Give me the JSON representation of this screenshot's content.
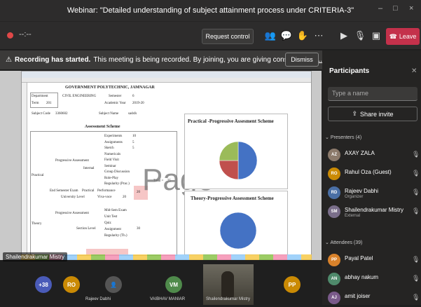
{
  "window": {
    "title": "Webinar: \"Detailed understanding of subject attainment process under CRITERIA-3\"",
    "controls": [
      "–",
      "□",
      "×"
    ]
  },
  "toolbar": {
    "elapsed": "--:--",
    "request_control": "Request control",
    "icons": [
      "people-icon",
      "chat-icon",
      "hand-icon",
      "more-icon",
      "camera-off-icon",
      "mic-off-icon",
      "share-icon"
    ],
    "glyphs": {
      "people": "👥",
      "chat": "💬",
      "hand": "✋",
      "more": "⋯",
      "camera": "▶",
      "mic": "🎙",
      "share": "▣"
    },
    "leave_label": "Leave",
    "leave_color": "#c4314b"
  },
  "banner": {
    "bold": "Recording has started.",
    "message": "This meeting is being recorded. By joining, you are giving consent for this meeting to be recorded.",
    "more": "Priv...",
    "dismiss": "Dismiss"
  },
  "shared_screen": {
    "sheet_title": "GOVERNMENT POLYTECHNIC, JAMNAGAR",
    "department_label": "Department",
    "department_value": "CIVIL ENGINEERING",
    "semester_label": "Semester",
    "semester_value": "6",
    "term_label": "Term",
    "term_value": "201",
    "academic_year_label": "Academic Year",
    "academic_year_value": "2019-20",
    "subject_code_label": "Subject Code",
    "subject_code_value": "3360602",
    "subject_name_label": "Subject Name",
    "subject_name_value": "sadsfs",
    "assessment_scheme": "Assessment Scheme",
    "practical_label": "Practical",
    "progressive_assessment": "Progressive Assessment",
    "internal": "Internal",
    "theory_label": "Theory",
    "end_sem_exam": "End Semester Exam",
    "practical_col": "Practical",
    "performance": "Performance",
    "viva": "Viva-voce",
    "university_level": "University Level",
    "section_level": "Section Level",
    "total_label": "Total =",
    "total_value": "75",
    "end_value": "20",
    "end_value_label": "20",
    "row_items": [
      "Experiments",
      "Assignments",
      "Sketch",
      "Numericals",
      "Field Visit",
      "Seminar",
      "Group Discussion",
      "Role-Play",
      "Regularity (Prac.)"
    ],
    "row_values": [
      "10",
      "5",
      "5"
    ],
    "theory_items": [
      "Mid-Sem Exam",
      "Unit Test",
      "Quiz",
      "Assignment",
      "Regularity (Th.)"
    ],
    "theory_values": [
      "30"
    ],
    "watermark": "Page",
    "chart1_title": "Practical -Progressive Assesment Scheme",
    "chart2_title": "Theory-Progressive Assessment Scheme",
    "presenter_tag": "Shailendrakumar Mistry"
  },
  "chart_data": [
    {
      "type": "pie",
      "title": "Practical -Progressive Assesment Scheme",
      "labels": [
        "Experiments",
        "Assignments",
        "Sketch"
      ],
      "values": [
        50,
        25,
        25
      ],
      "colors": [
        "#4472c4",
        "#c0504d",
        "#9bbb59"
      ]
    },
    {
      "type": "pie",
      "title": "Theory-Progressive Assessment Scheme",
      "labels": [
        "Mid-Sem Exam"
      ],
      "values": [
        100
      ],
      "colors": [
        "#4472c4"
      ]
    }
  ],
  "participants": {
    "title": "Participants",
    "search_placeholder": "Type a name",
    "share_invite": "Share invite",
    "presenters_header": "Presenters (4)",
    "attendees_header": "Attendees (39)",
    "presenters": [
      {
        "initials": "AZ",
        "name": "AXAY ZALA",
        "role": "",
        "color": "#8c7a6b"
      },
      {
        "initials": "RO",
        "name": "Rahul Oza (Guest)",
        "role": "",
        "color": "#ca8a04"
      },
      {
        "initials": "RD",
        "name": "Rajeev Dabhi",
        "role": "Organizer",
        "color": "#4a6fa5"
      },
      {
        "initials": "SM",
        "name": "Shailendrakumar Mistry",
        "role": "External",
        "color": "#7a6e8a"
      }
    ],
    "attendees": [
      {
        "initials": "PP",
        "name": "Payal Patel",
        "role": "",
        "color": "#d9822b"
      },
      {
        "initials": "AN",
        "name": "abhay nakum",
        "role": "",
        "color": "#4f8a6b"
      },
      {
        "initials": "AJ",
        "name": "amit joiser",
        "role": "",
        "color": "#7a5a8a"
      }
    ]
  },
  "video_strip": {
    "more_count": "+38",
    "tiles": [
      {
        "initials": "RO",
        "name": "",
        "color": "#ca8a04"
      },
      {
        "initials": "",
        "name": "Rajeev Dabhi",
        "color": "#3a3a3a"
      },
      {
        "initials": "VM",
        "name": "VAIBHAV MANIAR",
        "color": "#4f8a4b"
      },
      {
        "initials": "",
        "name": "Shailendrakumar Mistry",
        "color": ""
      },
      {
        "initials": "PP",
        "name": "",
        "color": "#ca8a04"
      }
    ]
  }
}
